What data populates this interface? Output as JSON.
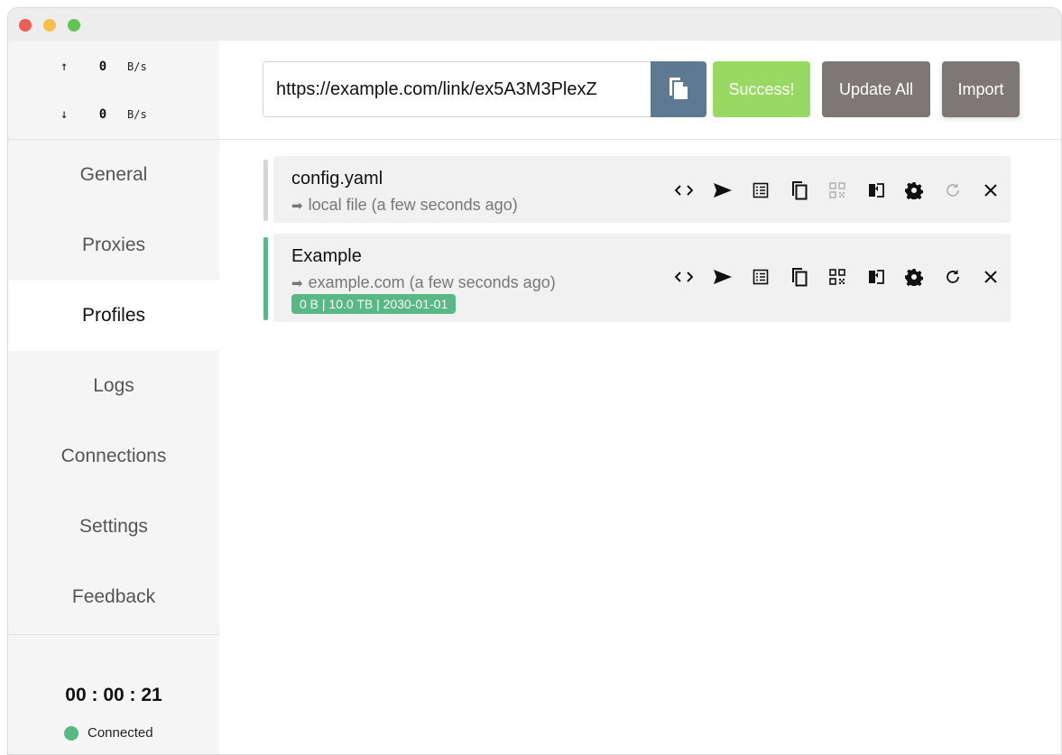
{
  "speed": {
    "up_arrow": "↑",
    "up_value": "0",
    "up_unit": "B/s",
    "down_arrow": "↓",
    "down_value": "0",
    "down_unit": "B/s"
  },
  "nav": {
    "general": "General",
    "proxies": "Proxies",
    "profiles": "Profiles",
    "logs": "Logs",
    "connections": "Connections",
    "settings": "Settings",
    "feedback": "Feedback",
    "active": "Profiles"
  },
  "footer": {
    "timer": "00 : 00 : 21",
    "status": "Connected",
    "status_color": "#59b986"
  },
  "toolbar": {
    "url_value": "https://example.com/link/ex5A3M3PlexZ",
    "paste_icon": "clipboard-paste-icon",
    "success_label": "Success!",
    "update_all_label": "Update All",
    "import_label": "Import"
  },
  "profiles": [
    {
      "name": "config.yaml",
      "source": "local file (a few seconds ago)",
      "source_icon": "arrow-right-icon",
      "selected": false,
      "refresh_enabled": false,
      "qr_enabled": false
    },
    {
      "name": "Example",
      "source": "example.com (a few seconds ago)",
      "source_icon": "arrow-right-icon",
      "usage": "0 B | 10.0 TB | 2030-01-01",
      "selected": true,
      "refresh_enabled": true,
      "qr_enabled": true
    }
  ],
  "profile_actions": [
    "code-icon",
    "send-icon",
    "list-icon",
    "copy-icon",
    "qrcode-icon",
    "compare-icon",
    "gear-icon",
    "refresh-icon",
    "close-icon"
  ],
  "colors": {
    "accent_green": "#59b986",
    "success_green": "#98d964",
    "paste_blue": "#5e7a93",
    "button_gray": "#7d7776"
  }
}
